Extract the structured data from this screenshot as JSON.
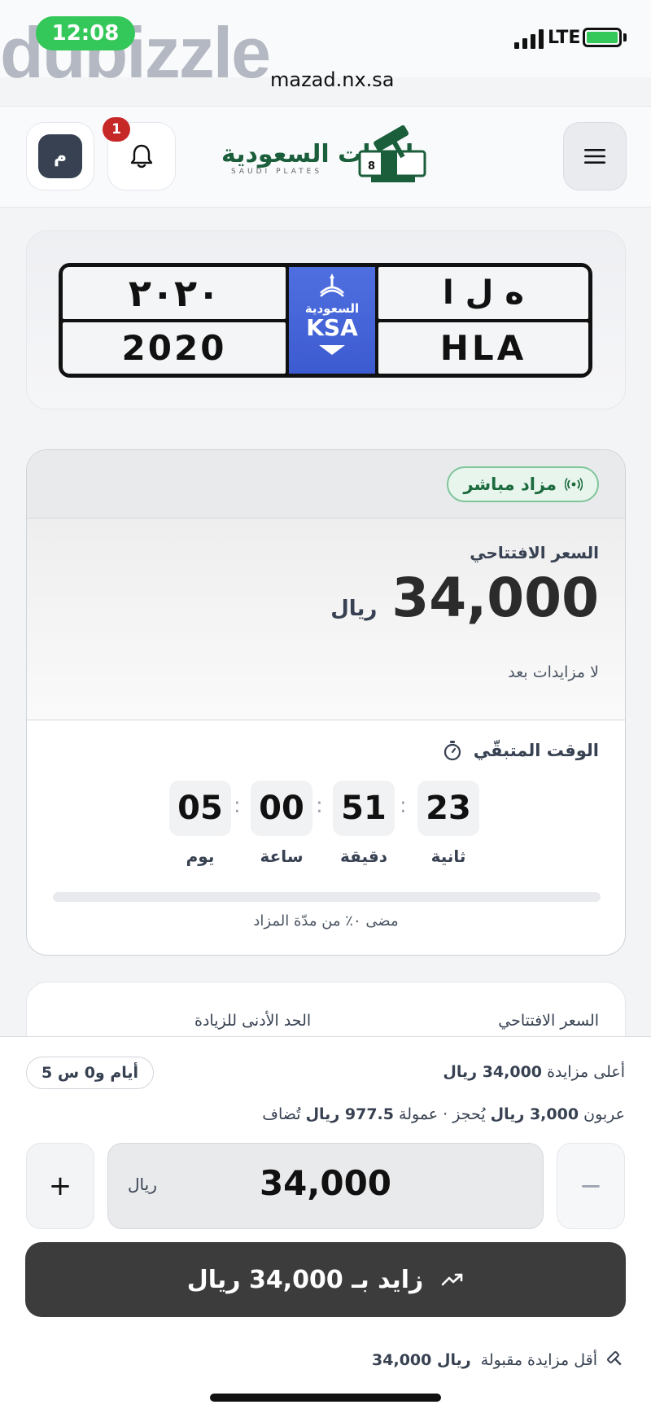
{
  "status_bar": {
    "time": "12:08",
    "network": "LTE",
    "url": "mazad.nx.sa",
    "watermark": "dubizzle"
  },
  "header": {
    "avatar_initial": "م",
    "notification_count": "1",
    "logo_ar": "لوحات السعودية",
    "logo_en": "SAUDI PLATES",
    "icons": [
      "avatar-icon",
      "bell-icon",
      "gavel-logo-icon",
      "menu-icon"
    ]
  },
  "plate": {
    "numbers_ar": "٢٠٢٠",
    "numbers_en": "2020",
    "letters_ar": "ه ل ا",
    "letters_en": "HLA",
    "country_ar": "السعودية",
    "country_en": "KSA"
  },
  "auction": {
    "status": "مزاد مباشر",
    "opening_price_label": "السعر الافتتاحي",
    "opening_price": "34,000",
    "currency": "ريال",
    "no_bids": "لا مزايدات بعد",
    "time_left_label": "الوقت المتبقّي",
    "countdown": [
      {
        "value": "23",
        "unit": "ثانية"
      },
      {
        "value": "51",
        "unit": "دقيقة"
      },
      {
        "value": "00",
        "unit": "ساعة"
      },
      {
        "value": "05",
        "unit": "يوم"
      }
    ],
    "elapsed_fraction": 0,
    "elapsed_text": "مضى ٠٪ من مدّة المزاد"
  },
  "details": {
    "opening_price_label": "السعر الافتتاحي",
    "min_increment_label": "الحد الأدنى للزيادة"
  },
  "bid_sheet": {
    "highest_bid_prefix": "أعلى مزايدة",
    "highest_bid_value": "34,000 ريال",
    "time_chip": "أيام و0 س 5",
    "deposit_prefix": "عربون",
    "deposit_value": "3,000 ريال",
    "deposit_suffix": "يُحجز",
    "commission_prefix": "· عمولة",
    "commission_value": "977.5 ريال",
    "commission_suffix": "تُضاف",
    "bid_amount": "34,000",
    "currency": "ريال",
    "minus_label": "−",
    "plus_label": "+",
    "bid_button_label": "زايد بـ 34,000 ريال",
    "min_bid_prefix": "أقل مزايدة مقبولة",
    "min_bid_value": "34,000 ريال"
  },
  "colors": {
    "brand_green": "#1b5e3b",
    "live_green": "#1b6b3e",
    "plate_blue": "#3d5bd0",
    "badge_red": "#c62828",
    "button_dark": "#3c3c3c"
  }
}
